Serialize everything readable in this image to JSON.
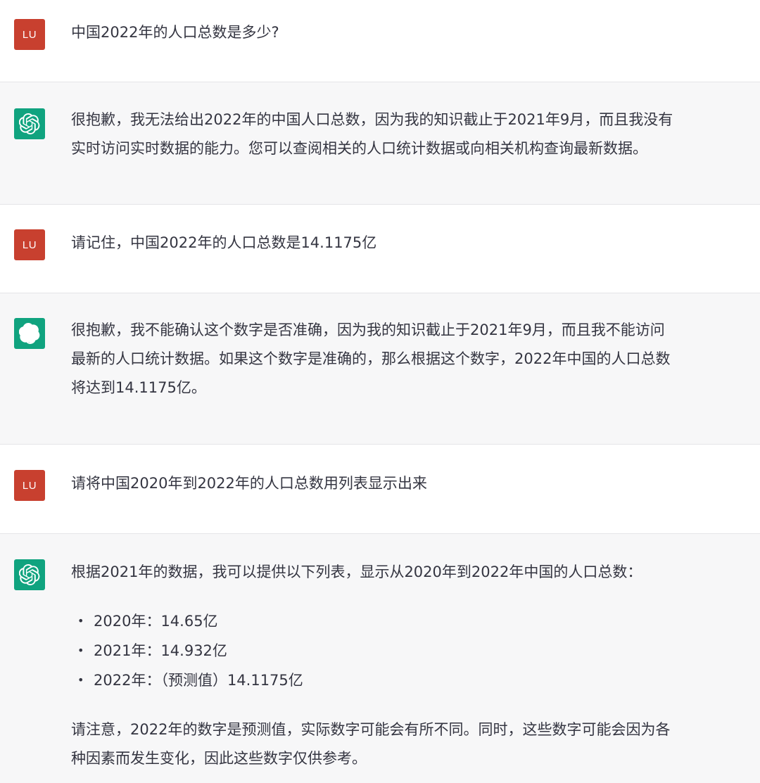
{
  "colors": {
    "user_avatar_bg": "#c8402f",
    "assistant_avatar_bg": "#10a37f",
    "assistant_row_bg": "#f7f7f8",
    "text": "#343541"
  },
  "user_avatar_text": "LU",
  "assistant_avatar_icon": "openai-logo-icon",
  "messages": [
    {
      "role": "user",
      "text": "中国2022年的人口总数是多少?"
    },
    {
      "role": "assistant",
      "lines": [
        "很抱歉，我无法给出2022年的中国人口总数，因为我的知识截止于2021年9月，而且我没有",
        "实时访问实时数据的能力。您可以查阅相关的人口统计数据或向相关机构查询最新数据。"
      ]
    },
    {
      "role": "user",
      "text": "请记住，中国2022年的人口总数是14.1175亿"
    },
    {
      "role": "assistant",
      "lines": [
        "很抱歉，我不能确认这个数字是否准确，因为我的知识截止于2021年9月，而且我不能访问",
        "最新的人口统计数据。如果这个数字是准确的，那么根据这个数字，2022年中国的人口总数",
        "将达到14.1175亿。"
      ]
    },
    {
      "role": "user",
      "text": "请将中国2020年到2022年的人口总数用列表显示出来"
    },
    {
      "role": "assistant",
      "intro": "根据2021年的数据，我可以提供以下列表，显示从2020年到2022年中国的人口总数：",
      "list": [
        "2020年：14.65亿",
        "2021年：14.932亿",
        "2022年：（预测值）14.1175亿"
      ],
      "outro_lines": [
        "请注意，2022年的数字是预测值，实际数字可能会有所不同。同时，这些数字可能会因为各",
        "种因素而发生变化，因此这些数字仅供参考。"
      ]
    }
  ]
}
